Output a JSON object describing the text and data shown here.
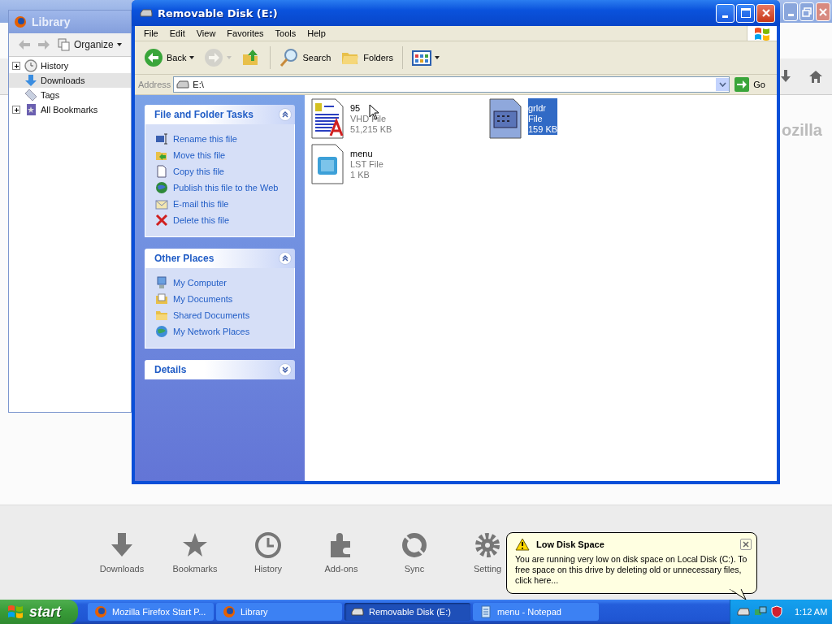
{
  "firefox": {
    "brand_fragment": "ozilla",
    "launcher": [
      {
        "kind": "downloads",
        "label": "Downloads"
      },
      {
        "kind": "bookmarks",
        "label": "Bookmarks"
      },
      {
        "kind": "history",
        "label": "History"
      },
      {
        "kind": "addons",
        "label": "Add-ons"
      },
      {
        "kind": "sync",
        "label": "Sync"
      },
      {
        "kind": "settings",
        "label": "Setting"
      }
    ]
  },
  "library": {
    "title": "Library",
    "organize": "Organize",
    "tree": [
      {
        "kind": "history",
        "label": "History",
        "expandable": true,
        "selected": false
      },
      {
        "kind": "downloads",
        "label": "Downloads",
        "expandable": false,
        "selected": true
      },
      {
        "kind": "tags",
        "label": "Tags",
        "expandable": false,
        "selected": false
      },
      {
        "kind": "bookmarks",
        "label": "All Bookmarks",
        "expandable": true,
        "selected": false
      }
    ]
  },
  "explorer": {
    "title": "Removable Disk (E:)",
    "menu": [
      "File",
      "Edit",
      "View",
      "Favorites",
      "Tools",
      "Help"
    ],
    "toolbar": [
      {
        "kind": "back",
        "label": "Back",
        "disabled": false
      },
      {
        "kind": "forward",
        "disabled": true
      },
      {
        "kind": "up",
        "disabled": false
      },
      {
        "kind": "search",
        "label": "Search",
        "disabled": false
      },
      {
        "kind": "folders",
        "label": "Folders",
        "disabled": false
      },
      {
        "kind": "views",
        "disabled": false
      }
    ],
    "address": {
      "label": "Address",
      "value": "E:\\",
      "go": "Go"
    },
    "panels": [
      {
        "title": "File and Folder Tasks",
        "expanded": true,
        "items": [
          {
            "kind": "rename",
            "label": "Rename this file"
          },
          {
            "kind": "move",
            "label": "Move this file"
          },
          {
            "kind": "copy",
            "label": "Copy this file"
          },
          {
            "kind": "web",
            "label": "Publish this file to the Web"
          },
          {
            "kind": "email",
            "label": "E-mail this file"
          },
          {
            "kind": "delete",
            "label": "Delete this file"
          }
        ]
      },
      {
        "title": "Other Places",
        "expanded": true,
        "items": [
          {
            "kind": "computer",
            "label": "My Computer"
          },
          {
            "kind": "documents",
            "label": "My Documents"
          },
          {
            "kind": "folder",
            "label": "Shared Documents"
          },
          {
            "kind": "network",
            "label": "My Network Places"
          }
        ]
      },
      {
        "title": "Details",
        "expanded": false
      }
    ],
    "files": [
      {
        "kind": "document",
        "name": "95",
        "type": "VHD File",
        "size": "51,215 KB",
        "selected": false
      },
      {
        "kind": "application",
        "name": "grldr",
        "type": "File",
        "size": "159 KB",
        "selected": true
      },
      {
        "kind": "generic",
        "name": "menu",
        "type": "LST File",
        "size": "1 KB",
        "selected": false
      }
    ]
  },
  "balloon": {
    "title": "Low Disk Space",
    "text": "You are running very low on disk space on Local Disk (C:). To free space on this drive by deleting old or unnecessary files, click here..."
  },
  "taskbar": {
    "start": "start",
    "tasks": [
      {
        "kind": "firefox",
        "label": "Mozilla Firefox Start P...",
        "selected": false
      },
      {
        "kind": "firefox",
        "label": "Library",
        "selected": false
      },
      {
        "kind": "drive",
        "label": "Removable Disk (E:)",
        "selected": true
      },
      {
        "kind": "notepad",
        "label": "menu - Notepad",
        "selected": false
      }
    ],
    "clock": "1:12 AM"
  }
}
